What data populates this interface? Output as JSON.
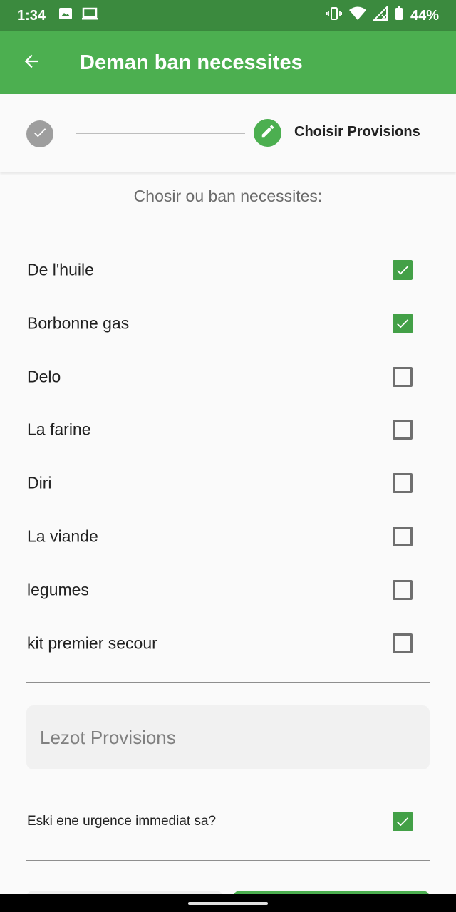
{
  "status_bar": {
    "time": "1:34",
    "battery": "44%",
    "icons": [
      "image-icon",
      "laptop-icon",
      "vibrate-icon",
      "wifi-icon",
      "signal-icon",
      "battery-icon"
    ]
  },
  "app_bar": {
    "title": "Deman ban necessites",
    "back_icon": "arrow-back-icon"
  },
  "stepper": {
    "steps": [
      {
        "state": "completed",
        "icon": "check-icon"
      },
      {
        "state": "active",
        "icon": "pencil-icon",
        "label": "Choisir Provisions"
      }
    ]
  },
  "prompt": "Chosir ou ban necessites:",
  "items": [
    {
      "label": "De l'huile",
      "checked": true
    },
    {
      "label": "Borbonne gas",
      "checked": true
    },
    {
      "label": "Delo",
      "checked": false
    },
    {
      "label": "La farine",
      "checked": false
    },
    {
      "label": "Diri",
      "checked": false
    },
    {
      "label": "La viande",
      "checked": false
    },
    {
      "label": "legumes",
      "checked": false
    },
    {
      "label": "kit premier secour",
      "checked": false
    }
  ],
  "other_field": {
    "value": "",
    "placeholder": "Lezot Provisions"
  },
  "urgent": {
    "label": "Eski ene urgence immediat sa?",
    "checked": true
  },
  "colors": {
    "status_bar": "#3b8a3e",
    "app_bar": "#4caf50",
    "checkbox_checked": "#43a047",
    "step_done": "#9e9e9e"
  }
}
